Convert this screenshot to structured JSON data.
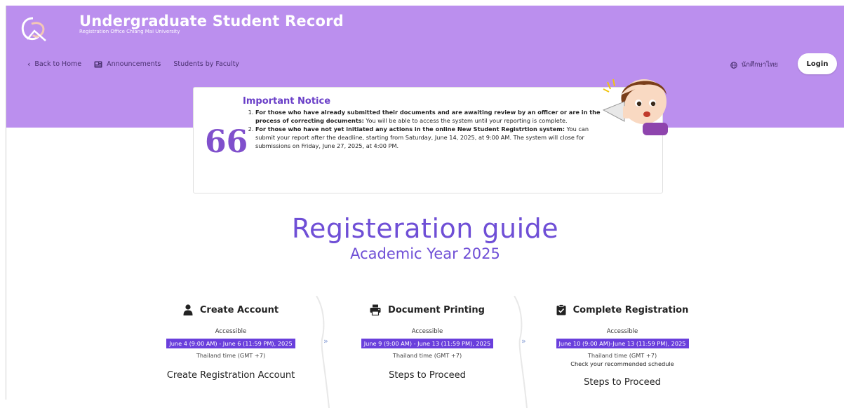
{
  "header": {
    "title": "Undergraduate Student Record",
    "subtitle": "Registration Office Chiang Mai University",
    "nav": [
      {
        "label": "Back to Home",
        "icon": "chevron-left-icon"
      },
      {
        "label": "Announcements",
        "icon": "newspaper-icon"
      },
      {
        "label": "Students by Faculty"
      }
    ],
    "language": "นักศึกษาไทย",
    "login_label": "Login"
  },
  "notice": {
    "title": "Important Notice",
    "quote_glyph": "66",
    "items": [
      {
        "bold": "For those who have already submitted their documents and are awaiting review by an officer or are in the process of correcting documents:",
        "text": " You will be able to access the system until your reporting is complete."
      },
      {
        "bold": "For those who have not yet initiated any actions in the online New Student Registrtion system:",
        "text": " You can submit your report after the deadline, starting from Saturday, June 14, 2025, at 9:00 AM. The system will close for submissions on Friday, June 27, 2025, at 4:00 PM."
      }
    ]
  },
  "guide": {
    "title": "Registeration guide",
    "subtitle": "Academic Year 2025"
  },
  "steps": [
    {
      "title": "Create Account",
      "icon": "user-icon",
      "access": "Accessible",
      "dates": "June 4 (9:00 AM) - June 6 (11:59 PM), 2025",
      "timezone": "Thailand time (GMT +7)",
      "extra": "",
      "action": "Create Registration Account"
    },
    {
      "title": "Document Printing",
      "icon": "printer-icon",
      "access": "Accessible",
      "dates": "June 9 (9:00 AM) - June 13 (11:59 PM), 2025",
      "timezone": "Thailand time (GMT +7)",
      "extra": "",
      "action": "Steps to Proceed"
    },
    {
      "title": "Complete Registration",
      "icon": "clipboard-check-icon",
      "access": "Accessible",
      "dates": "June 10 (9:00 AM)-June 13 (11:59 PM), 2025",
      "timezone": "Thailand time (GMT +7)",
      "extra": "Check your recommended schedule",
      "action": "Steps to Proceed"
    }
  ],
  "step_arrow": "»",
  "colors": {
    "header_bg": "#bb8fee",
    "accent": "#6f4fd6",
    "date_badge": "#6a3fdc"
  }
}
